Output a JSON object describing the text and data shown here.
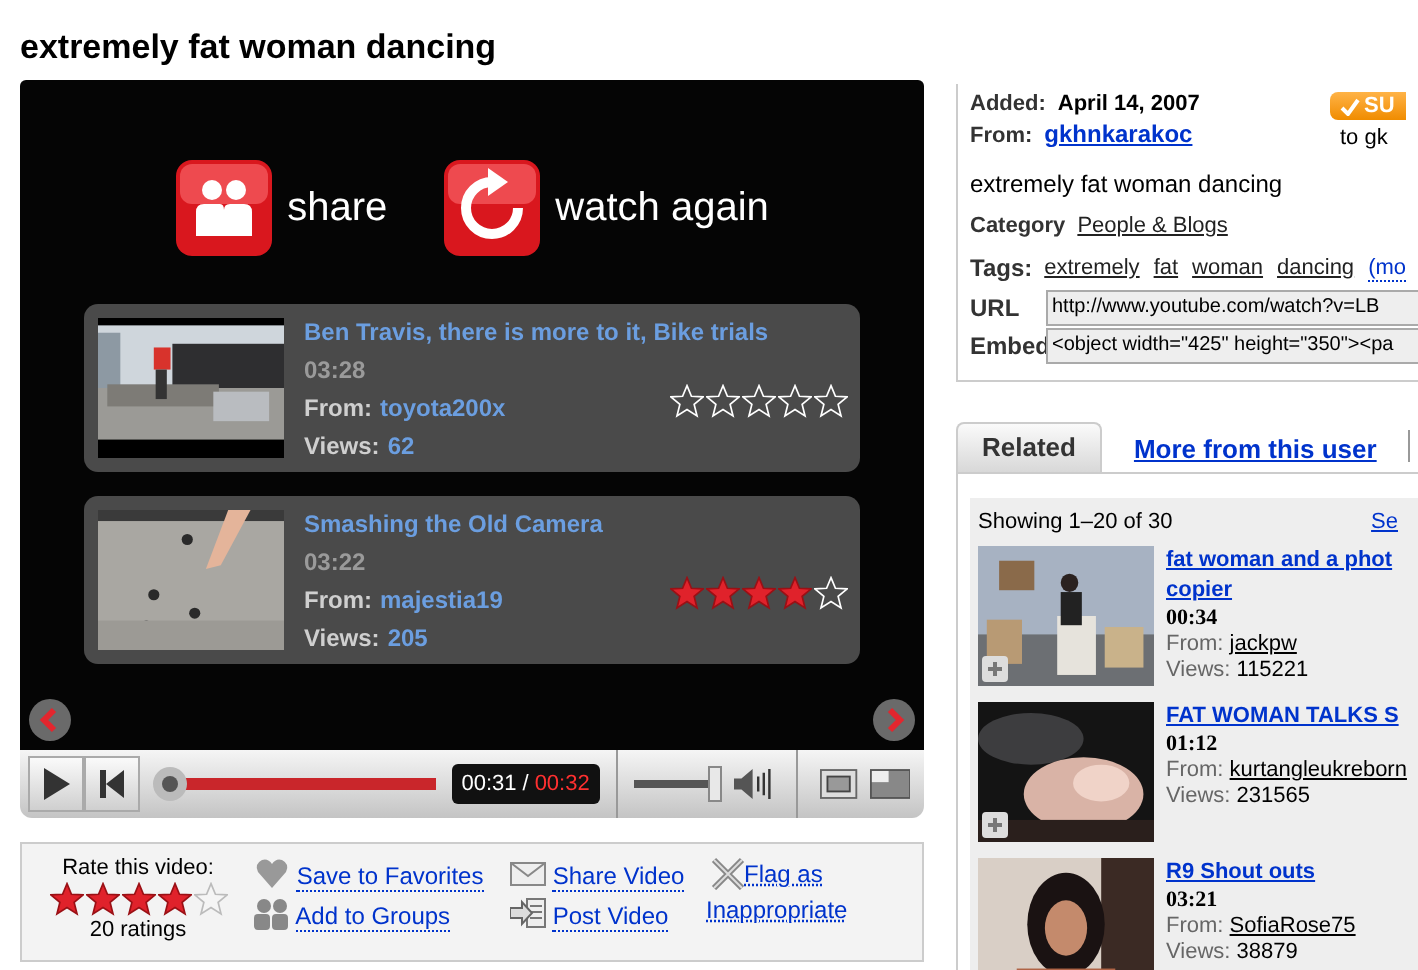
{
  "title": "extremely fat woman dancing",
  "player": {
    "end_actions": [
      {
        "kind": "share",
        "label": "share"
      },
      {
        "kind": "replay",
        "label": "watch again"
      }
    ],
    "suggestions": [
      {
        "title": "Ben Travis, there is more to it, Bike trials",
        "duration": "03:28",
        "from_label": "From:",
        "user": "toyota200x",
        "views_label": "Views:",
        "views": "62",
        "stars": 0
      },
      {
        "title": "Smashing the Old Camera",
        "duration": "03:22",
        "from_label": "From:",
        "user": "majestia19",
        "views_label": "Views:",
        "views": "205",
        "stars": 4
      }
    ],
    "controls": {
      "progress": {
        "level": 1
      },
      "time_current": "00:31",
      "time_separator": "/",
      "time_total": "00:32",
      "volume": {
        "level": 0.9
      }
    }
  },
  "rating": {
    "prompt": "Rate this video:",
    "stars": 4,
    "count": "20 ratings"
  },
  "actions": [
    {
      "kind": "favorite",
      "label": "Save to Favorites"
    },
    {
      "kind": "groups",
      "label": "Add to Groups"
    },
    {
      "kind": "share",
      "label": "Share Video"
    },
    {
      "kind": "post",
      "label": "Post Video"
    },
    {
      "kind": "flag",
      "label": "Flag as Inappropriate"
    }
  ],
  "info": {
    "added_label": "Added:",
    "added": "April 14, 2007",
    "from_label": "From:",
    "user": "gkhnkarakoc",
    "subscribe": "SU",
    "subscribe_note": "to gk",
    "description": "extremely fat woman dancing",
    "category_label": "Category",
    "category": "People & Blogs",
    "tags_label": "Tags:",
    "tags": [
      "extremely",
      "fat",
      "woman",
      "dancing"
    ],
    "tags_more": "(mo",
    "url_label": "URL",
    "url": "http://www.youtube.com/watch?v=LB",
    "embed_label": "Embed",
    "embed": "<object width=\"425\" height=\"350\"><pa"
  },
  "tabs": [
    {
      "label": "Related",
      "selected": true
    },
    {
      "label": "More from this user",
      "selected": false
    }
  ],
  "related": {
    "showing": "Showing 1–20 of 30",
    "see": "Se",
    "videos": [
      {
        "title_lines": [
          "fat woman and a phot",
          "copier"
        ],
        "duration": "00:34",
        "from_label": "From:",
        "user": "jackpw",
        "views_label": "Views:",
        "views": "115221"
      },
      {
        "title_lines": [
          "FAT WOMAN TALKS S"
        ],
        "duration": "01:12",
        "from_label": "From:",
        "user": "kurtangleukreborn",
        "views_label": "Views:",
        "views": "231565"
      },
      {
        "title_lines": [
          "R9 Shout outs"
        ],
        "duration": "03:21",
        "from_label": "From:",
        "user": "SofiaRose75",
        "views_label": "Views:",
        "views": "38879"
      }
    ]
  }
}
